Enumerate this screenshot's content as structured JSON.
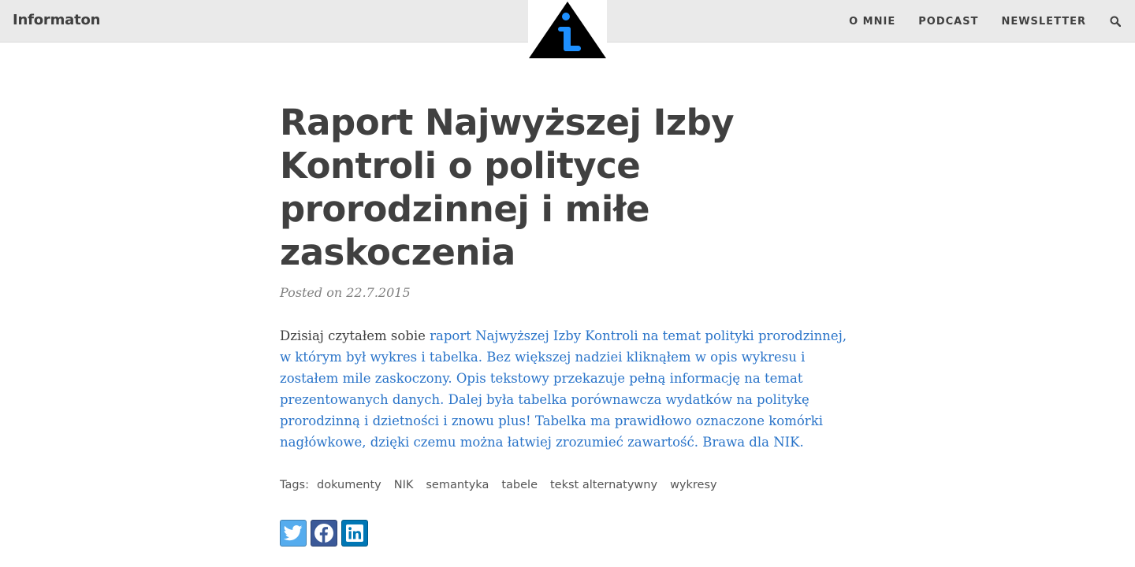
{
  "header": {
    "brand": "Informaton",
    "nav": [
      "O MNIE",
      "PODCAST",
      "NEWSLETTER"
    ]
  },
  "post": {
    "title_lines": [
      "Raport Najwyższej Izby",
      "Kontroli o polityce",
      "prorodzinnej i miłe",
      "zaskoczenia"
    ],
    "meta": "Posted on 22.7.2015",
    "body_intro": "Dzisiaj czytałem sobie ",
    "body_link": "raport Najwyższej Izby Kontroli na temat polityki prorodzinnej, w którym był wykres i tabelka. Bez większej nadziei kliknąłem w opis wykresu i zostałem mile zaskoczony. Opis tekstowy przekazuje pełną informację na temat prezentowanych danych. Dalej była tabelka porównawcza wydatków na politykę prorodzinną i dzietności i znowu plus! Tabelka ma prawidłowo oznaczone komórki nagłówkowe, dzięki czemu można łatwiej zrozumieć zawartość. Brawa dla NIK."
  },
  "tags": {
    "label": "Tags:",
    "items": [
      "dokumenty",
      "NIK",
      "semantyka",
      "tabele",
      "tekst alternatywny",
      "wykresy"
    ]
  },
  "colors": {
    "link": "#2a74c9",
    "twitter": "#55acee",
    "facebook": "#3b5998",
    "linkedin": "#0077b5",
    "logo_accent": "#1e90ff"
  },
  "icons": {
    "search": "search-icon",
    "logo": "info-triangle-logo",
    "share": [
      "twitter-icon",
      "facebook-icon",
      "linkedin-icon"
    ]
  }
}
